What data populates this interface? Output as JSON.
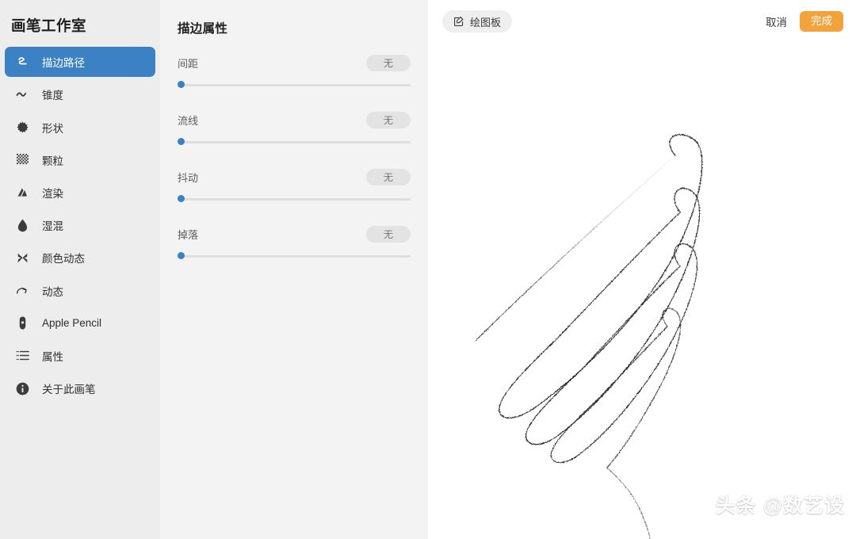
{
  "sidebar": {
    "title": "画笔工作室",
    "items": [
      {
        "label": "描边路径",
        "icon": "stroke-path-icon",
        "active": true
      },
      {
        "label": "锥度",
        "icon": "taper-icon",
        "active": false
      },
      {
        "label": "形状",
        "icon": "shape-icon",
        "active": false
      },
      {
        "label": "颗粒",
        "icon": "grain-icon",
        "active": false
      },
      {
        "label": "渲染",
        "icon": "rendering-icon",
        "active": false
      },
      {
        "label": "湿混",
        "icon": "wet-mix-icon",
        "active": false
      },
      {
        "label": "颜色动态",
        "icon": "color-dynamics-icon",
        "active": false
      },
      {
        "label": "动态",
        "icon": "dynamics-icon",
        "active": false
      },
      {
        "label": "Apple Pencil",
        "icon": "apple-pencil-icon",
        "active": false
      },
      {
        "label": "属性",
        "icon": "properties-icon",
        "active": false
      },
      {
        "label": "关于此画笔",
        "icon": "info-icon",
        "active": false
      }
    ]
  },
  "properties": {
    "title": "描边属性",
    "sliders": [
      {
        "label": "间距",
        "value": "无",
        "fill": 0
      },
      {
        "label": "流线",
        "value": "无",
        "fill": 0
      },
      {
        "label": "抖动",
        "value": "无",
        "fill": 0
      },
      {
        "label": "掉落",
        "value": "无",
        "fill": 0
      }
    ]
  },
  "canvas": {
    "drawing_pad_button": "绘图板",
    "drawing_pad_icon": "edit-square-icon",
    "cancel_button": "取消",
    "done_button": "完成",
    "watermark": "头条 @数艺设"
  },
  "colors": {
    "accent_blue": "#3B81C4",
    "accent_orange": "#F2A33C",
    "sidebar_bg": "#ECEDEC",
    "panel_bg": "#F2F3F2",
    "canvas_bg": "#FFFFFF"
  }
}
